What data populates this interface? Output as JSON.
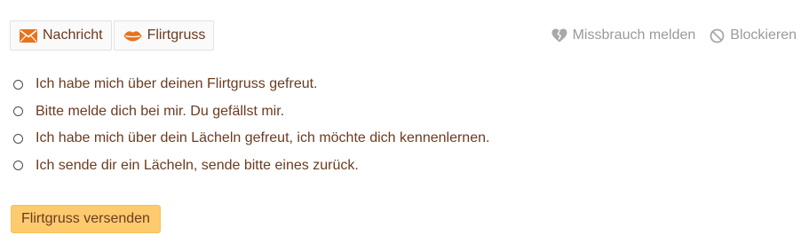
{
  "toolbar": {
    "message_label": "Nachricht",
    "message_icon": "envelope-icon",
    "flirt_label": "Flirtgruss",
    "flirt_icon": "lips-icon"
  },
  "actions": {
    "report_label": "Missbrauch melden",
    "report_icon": "broken-heart-icon",
    "block_label": "Blockieren",
    "block_icon": "block-icon"
  },
  "options": [
    {
      "label": "Ich habe mich über deinen Flirtgruss gefreut."
    },
    {
      "label": "Bitte melde dich bei mir. Du gefällst mir."
    },
    {
      "label": "Ich habe mich über dein Lächeln gefreut, ich möchte dich kennenlernen."
    },
    {
      "label": "Ich sende dir ein Lächeln, sende bitte eines zurück."
    }
  ],
  "send_button": {
    "label": "Flirtgruss versenden"
  },
  "colors": {
    "text": "#6b3b1f",
    "accent": "#e8731c",
    "muted": "#9a9a9a",
    "button": "#fdcb6e"
  }
}
